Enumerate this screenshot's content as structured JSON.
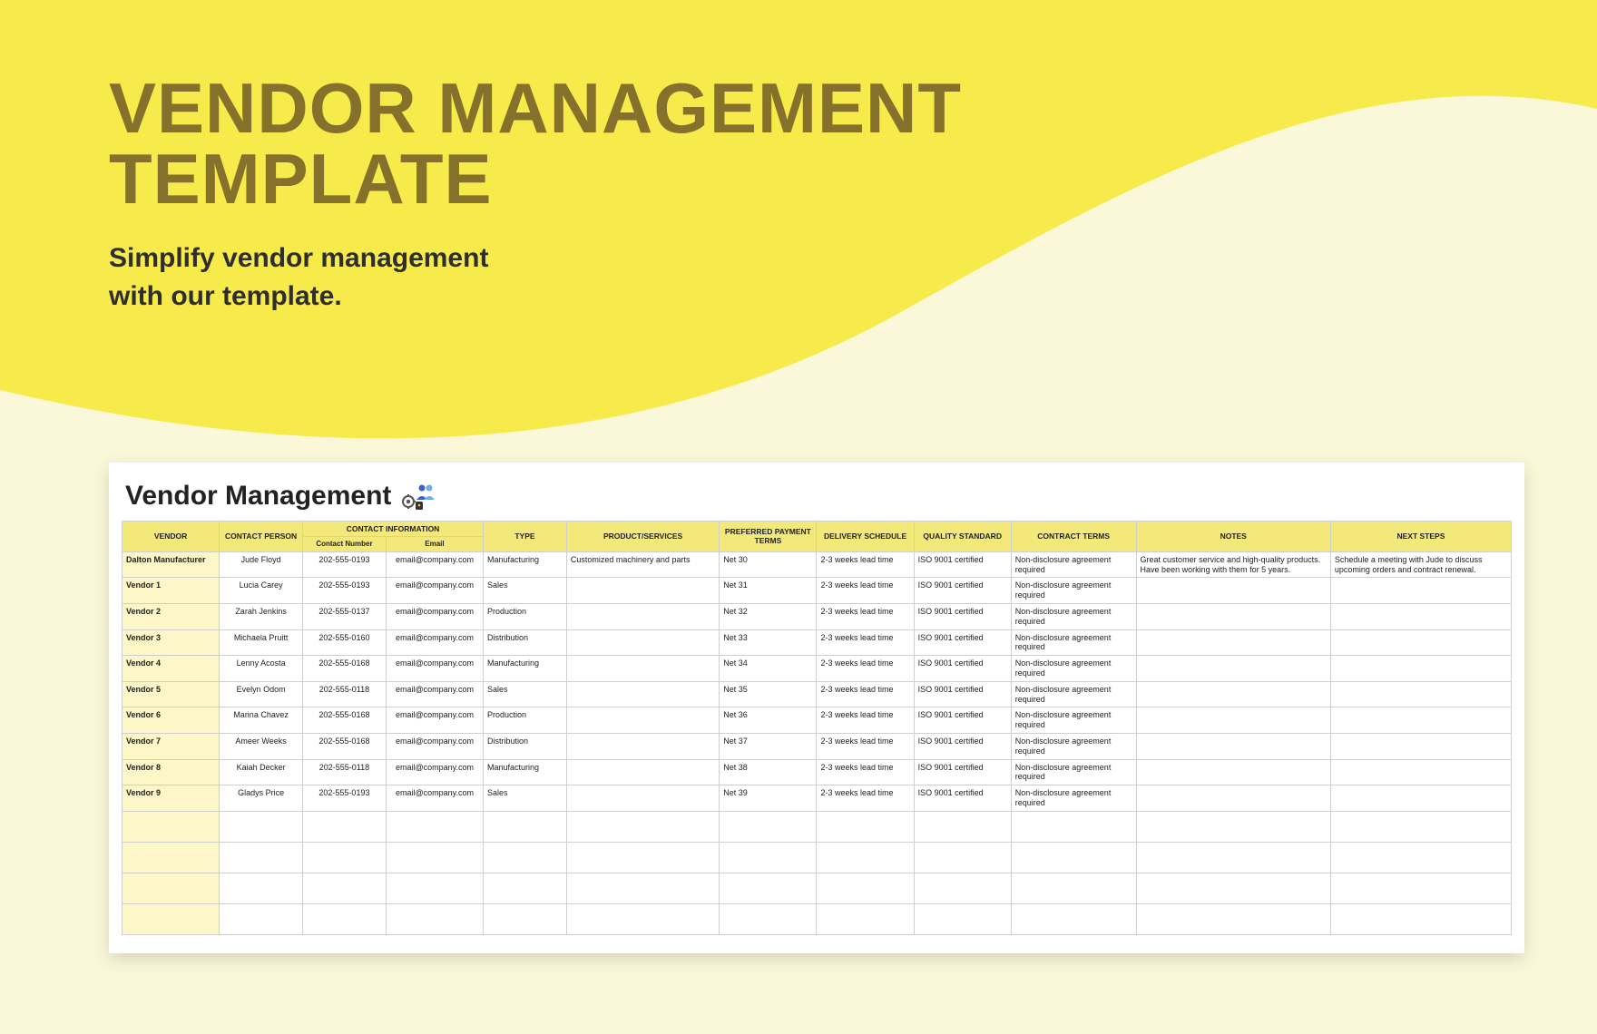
{
  "hero": {
    "title_line1": "VENDOR MANAGEMENT",
    "title_line2": "TEMPLATE",
    "sub_line1": "Simplify vendor management",
    "sub_line2": "with our template."
  },
  "sheet": {
    "title": "Vendor Management",
    "headers": {
      "vendor": "VENDOR",
      "contact_person": "CONTACT PERSON",
      "contact_info": "CONTACT INFORMATION",
      "contact_number": "Contact Number",
      "email": "Email",
      "type": "TYPE",
      "product_services": "PRODUCT/SERVICES",
      "payment_terms": "PREFERRED PAYMENT TERMS",
      "delivery": "DELIVERY SCHEDULE",
      "quality": "QUALITY STANDARD",
      "contract": "CONTRACT TERMS",
      "notes": "NOTES",
      "next": "NEXT STEPS"
    },
    "rows": [
      {
        "vendor": "Dalton Manufacturer",
        "person": "Jude Floyd",
        "num": "202-555-0193",
        "email": "email@company.com",
        "type": "Manufacturing",
        "prod": "Customized machinery and parts",
        "pay": "Net 30",
        "del": "2-3 weeks lead time",
        "qual": "ISO 9001 certified",
        "terms": "Non-disclosure agreement required",
        "notes": "Great customer service and high-quality products. Have been working with them for 5 years.",
        "next": "Schedule a meeting with Jude to discuss upcoming orders and contract renewal."
      },
      {
        "vendor": "Vendor 1",
        "person": "Lucia Carey",
        "num": "202-555-0193",
        "email": "email@company.com",
        "type": "Sales",
        "prod": "",
        "pay": "Net 31",
        "del": "2-3 weeks lead time",
        "qual": "ISO 9001 certified",
        "terms": "Non-disclosure agreement required",
        "notes": "",
        "next": ""
      },
      {
        "vendor": "Vendor 2",
        "person": "Zarah Jenkins",
        "num": "202-555-0137",
        "email": "email@company.com",
        "type": "Production",
        "prod": "",
        "pay": "Net 32",
        "del": "2-3 weeks lead time",
        "qual": "ISO 9001 certified",
        "terms": "Non-disclosure agreement required",
        "notes": "",
        "next": ""
      },
      {
        "vendor": "Vendor 3",
        "person": "Michaela Pruitt",
        "num": "202-555-0160",
        "email": "email@company.com",
        "type": "Distribution",
        "prod": "",
        "pay": "Net 33",
        "del": "2-3 weeks lead time",
        "qual": "ISO 9001 certified",
        "terms": "Non-disclosure agreement required",
        "notes": "",
        "next": ""
      },
      {
        "vendor": "Vendor 4",
        "person": "Lenny Acosta",
        "num": "202-555-0168",
        "email": "email@company.com",
        "type": "Manufacturing",
        "prod": "",
        "pay": "Net 34",
        "del": "2-3 weeks lead time",
        "qual": "ISO 9001 certified",
        "terms": "Non-disclosure agreement required",
        "notes": "",
        "next": ""
      },
      {
        "vendor": "Vendor 5",
        "person": "Evelyn Odom",
        "num": "202-555-0118",
        "email": "email@company.com",
        "type": "Sales",
        "prod": "",
        "pay": "Net 35",
        "del": "2-3 weeks lead time",
        "qual": "ISO 9001 certified",
        "terms": "Non-disclosure agreement required",
        "notes": "",
        "next": ""
      },
      {
        "vendor": "Vendor 6",
        "person": "Marina Chavez",
        "num": "202-555-0168",
        "email": "email@company.com",
        "type": "Production",
        "prod": "",
        "pay": "Net 36",
        "del": "2-3 weeks lead time",
        "qual": "ISO 9001 certified",
        "terms": "Non-disclosure agreement required",
        "notes": "",
        "next": ""
      },
      {
        "vendor": "Vendor 7",
        "person": "Ameer Weeks",
        "num": "202-555-0168",
        "email": "email@company.com",
        "type": "Distribution",
        "prod": "",
        "pay": "Net 37",
        "del": "2-3 weeks lead time",
        "qual": "ISO 9001 certified",
        "terms": "Non-disclosure agreement required",
        "notes": "",
        "next": ""
      },
      {
        "vendor": "Vendor 8",
        "person": "Kaiah Decker",
        "num": "202-555-0118",
        "email": "email@company.com",
        "type": "Manufacturing",
        "prod": "",
        "pay": "Net 38",
        "del": "2-3 weeks lead time",
        "qual": "ISO 9001 certified",
        "terms": "Non-disclosure agreement required",
        "notes": "",
        "next": ""
      },
      {
        "vendor": "Vendor 9",
        "person": "Gladys Price",
        "num": "202-555-0193",
        "email": "email@company.com",
        "type": "Sales",
        "prod": "",
        "pay": "Net 39",
        "del": "2-3 weeks lead time",
        "qual": "ISO 9001 certified",
        "terms": "Non-disclosure agreement required",
        "notes": "",
        "next": ""
      }
    ],
    "empty_rows": 4
  }
}
